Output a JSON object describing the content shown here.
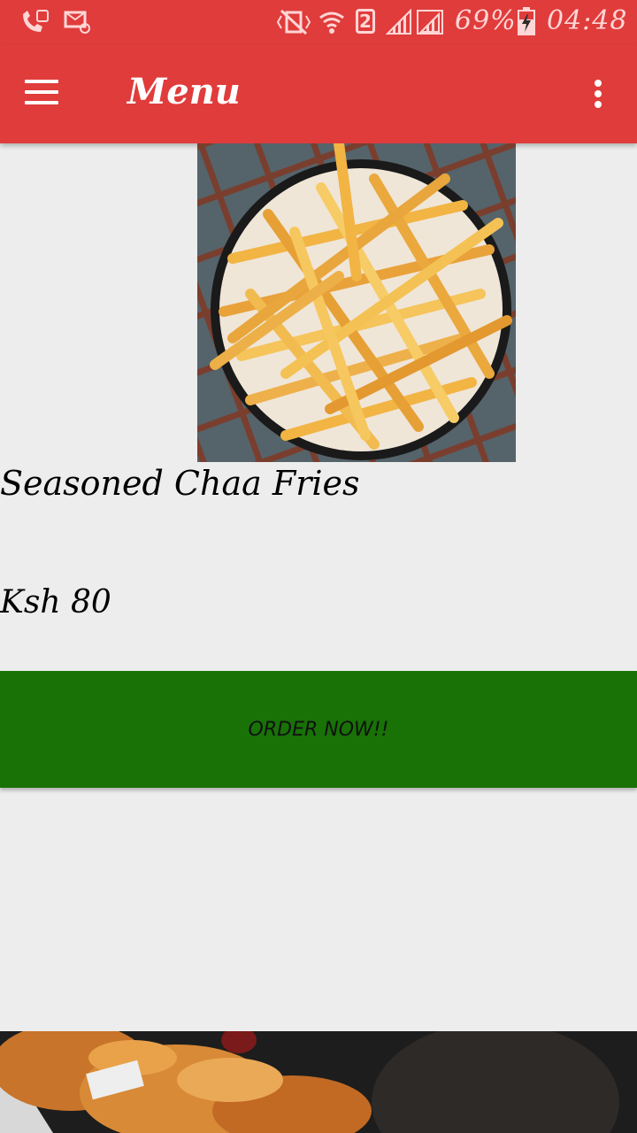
{
  "status_bar": {
    "battery": "69%",
    "time": "04:48",
    "sim_number": "2"
  },
  "app_bar": {
    "title": "Menu"
  },
  "item": {
    "name": "Seasoned Chaa Fries",
    "price": "Ksh 80",
    "order_label": "ORDER NOW!!"
  },
  "icons": {
    "call": "call-forward-icon",
    "message": "email-icon",
    "mute": "vibrate-mute-icon",
    "wifi": "wifi-icon",
    "signal": "signal-icon",
    "battery": "battery-charging-icon",
    "menu": "hamburger-menu-icon",
    "overflow": "more-vert-icon"
  },
  "colors": {
    "app_bar": "#e03c3c",
    "order_button": "#187206",
    "background": "#ededed"
  }
}
